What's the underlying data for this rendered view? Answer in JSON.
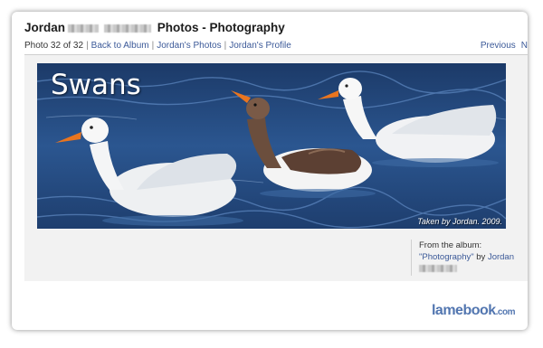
{
  "header": {
    "owner_first_name": "Jordan",
    "title_suffix": "Photos - Photography"
  },
  "breadcrumb": {
    "photo_position": "Photo 32 of 32",
    "back_to_album": "Back to Album",
    "owner_photos": "Jordan's Photos",
    "owner_profile": "Jordan's Profile",
    "separator": "|"
  },
  "nav": {
    "previous": "Previous",
    "next_partial": "N"
  },
  "photo": {
    "title_overlay": "Swans",
    "caption": "Taken by Jordan. 2009."
  },
  "album_info": {
    "label": "From the album:",
    "album_name": "\"Photography\"",
    "by": "by",
    "owner": "Jordan"
  },
  "watermark": {
    "brand": "lamebook",
    "tld": ".com"
  },
  "colors": {
    "link": "#3b5998",
    "water": "#24477a",
    "photo_area_bg": "#f2f2f2"
  }
}
